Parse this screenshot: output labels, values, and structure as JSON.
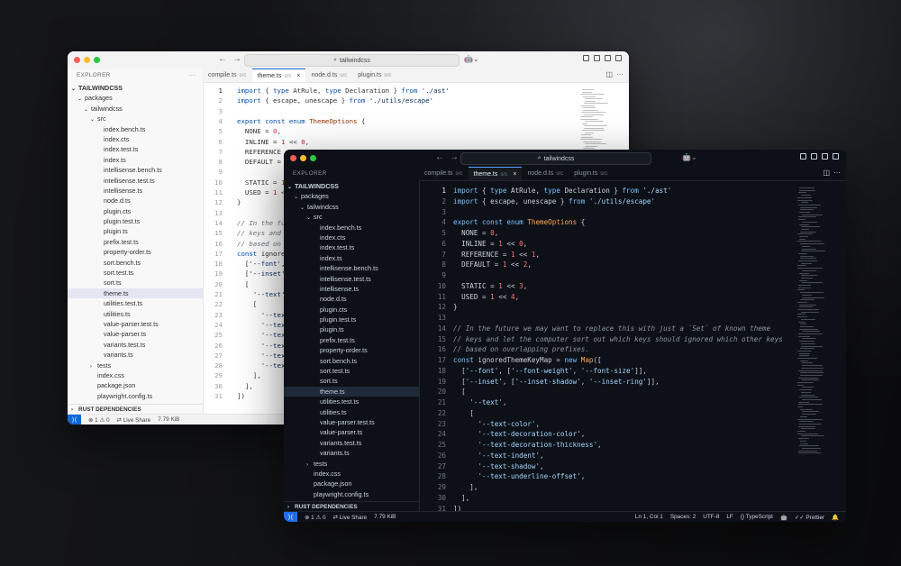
{
  "search_text": "tailwindcss",
  "tabs": [
    {
      "name": "compile.ts",
      "dir": "src",
      "active": false
    },
    {
      "name": "theme.ts",
      "dir": "src",
      "active": true
    },
    {
      "name": "node.d.ts",
      "dir": "src",
      "active": false
    },
    {
      "name": "plugin.ts",
      "dir": "src",
      "active": false
    }
  ],
  "explorer_label": "EXPLORER",
  "explorer_more": "···",
  "tree": [
    {
      "label": "TAILWINDCSS",
      "depth": 0,
      "twisty": "⌄",
      "bold": true
    },
    {
      "label": "packages",
      "depth": 1,
      "twisty": "⌄"
    },
    {
      "label": "tailwindcss",
      "depth": 2,
      "twisty": "⌄"
    },
    {
      "label": "src",
      "depth": 3,
      "twisty": "⌄"
    },
    {
      "label": "index.bench.ts",
      "depth": 4
    },
    {
      "label": "index.cts",
      "depth": 4
    },
    {
      "label": "index.test.ts",
      "depth": 4
    },
    {
      "label": "index.ts",
      "depth": 4
    },
    {
      "label": "intellisense.bench.ts",
      "depth": 4
    },
    {
      "label": "intellisense.test.ts",
      "depth": 4
    },
    {
      "label": "intellisense.ts",
      "depth": 4
    },
    {
      "label": "node.d.ts",
      "depth": 4
    },
    {
      "label": "plugin.cts",
      "depth": 4
    },
    {
      "label": "plugin.test.ts",
      "depth": 4
    },
    {
      "label": "plugin.ts",
      "depth": 4
    },
    {
      "label": "prefix.test.ts",
      "depth": 4
    },
    {
      "label": "property-order.ts",
      "depth": 4
    },
    {
      "label": "sort.bench.ts",
      "depth": 4
    },
    {
      "label": "sort.test.ts",
      "depth": 4
    },
    {
      "label": "sort.ts",
      "depth": 4
    },
    {
      "label": "theme.ts",
      "depth": 4,
      "selected": true
    },
    {
      "label": "utilities.test.ts",
      "depth": 4
    },
    {
      "label": "utilities.ts",
      "depth": 4
    },
    {
      "label": "value-parser.test.ts",
      "depth": 4
    },
    {
      "label": "value-parser.ts",
      "depth": 4
    },
    {
      "label": "variants.test.ts",
      "depth": 4
    },
    {
      "label": "variants.ts",
      "depth": 4
    },
    {
      "label": "tests",
      "depth": 3,
      "twisty": "›"
    },
    {
      "label": "index.css",
      "depth": 3
    },
    {
      "label": "package.json",
      "depth": 3
    },
    {
      "label": "playwright.config.ts",
      "depth": 3
    }
  ],
  "rust_label": "RUST DEPENDENCIES",
  "code": [
    [
      [
        "kw",
        "import"
      ],
      [
        "p",
        " { "
      ],
      [
        "kw",
        "type"
      ],
      [
        "p",
        " AtRule, "
      ],
      [
        "kw",
        "type"
      ],
      [
        "p",
        " Declaration } "
      ],
      [
        "kw",
        "from"
      ],
      [
        "p",
        " "
      ],
      [
        "str",
        "'./ast'"
      ]
    ],
    [
      [
        "kw",
        "import"
      ],
      [
        "p",
        " { escape, unescape } "
      ],
      [
        "kw",
        "from"
      ],
      [
        "p",
        " "
      ],
      [
        "str",
        "'./utils/escape'"
      ]
    ],
    [],
    [
      [
        "kw",
        "export const enum"
      ],
      [
        "p",
        " "
      ],
      [
        "ty",
        "ThemeOptions"
      ],
      [
        "p",
        " {"
      ]
    ],
    [
      [
        "p",
        "  NONE = "
      ],
      [
        "nm",
        "0"
      ],
      [
        "p",
        ","
      ]
    ],
    [
      [
        "p",
        "  INLINE = "
      ],
      [
        "nm",
        "1"
      ],
      [
        "p",
        " << "
      ],
      [
        "nm",
        "0"
      ],
      [
        "p",
        ","
      ]
    ],
    [
      [
        "p",
        "  REFERENCE = "
      ],
      [
        "nm",
        "1"
      ],
      [
        "p",
        " << "
      ],
      [
        "nm",
        "1"
      ],
      [
        "p",
        ","
      ]
    ],
    [
      [
        "p",
        "  DEFAULT = "
      ],
      [
        "nm",
        "1"
      ],
      [
        "p",
        " << "
      ],
      [
        "nm",
        "2"
      ],
      [
        "p",
        ","
      ]
    ],
    [],
    [
      [
        "p",
        "  STATIC = "
      ],
      [
        "nm",
        "1"
      ],
      [
        "p",
        " << "
      ],
      [
        "nm",
        "3"
      ],
      [
        "p",
        ","
      ]
    ],
    [
      [
        "p",
        "  USED = "
      ],
      [
        "nm",
        "1"
      ],
      [
        "p",
        " << "
      ],
      [
        "nm",
        "4"
      ],
      [
        "p",
        ","
      ]
    ],
    [
      [
        "p",
        "}"
      ]
    ],
    [],
    [
      [
        "cm",
        "// In the future we may want to replace this with just a `Set` of known theme"
      ]
    ],
    [
      [
        "cm",
        "// keys and let the computer sort out which keys should ignored which other keys"
      ]
    ],
    [
      [
        "cm",
        "// based on overlapping prefixes."
      ]
    ],
    [
      [
        "kw",
        "const"
      ],
      [
        "p",
        " ignoredThemeKeyMap = "
      ],
      [
        "kw",
        "new"
      ],
      [
        "p",
        " "
      ],
      [
        "ty",
        "Map"
      ],
      [
        "p",
        "(["
      ]
    ],
    [
      [
        "p",
        "  ["
      ],
      [
        "str",
        "'--font'"
      ],
      [
        "p",
        ", ["
      ],
      [
        "str",
        "'--font-weight'"
      ],
      [
        "p",
        ", "
      ],
      [
        "str",
        "'--font-size'"
      ],
      [
        "p",
        "]],"
      ]
    ],
    [
      [
        "p",
        "  ["
      ],
      [
        "str",
        "'--inset'"
      ],
      [
        "p",
        ", ["
      ],
      [
        "str",
        "'--inset-shadow'"
      ],
      [
        "p",
        ", "
      ],
      [
        "str",
        "'--inset-ring'"
      ],
      [
        "p",
        "]],"
      ]
    ],
    [
      [
        "p",
        "  ["
      ]
    ],
    [
      [
        "p",
        "    "
      ],
      [
        "str",
        "'--text'"
      ],
      [
        "p",
        ","
      ]
    ],
    [
      [
        "p",
        "    ["
      ]
    ],
    [
      [
        "p",
        "      "
      ],
      [
        "str",
        "'--text-color'"
      ],
      [
        "p",
        ","
      ]
    ],
    [
      [
        "p",
        "      "
      ],
      [
        "str",
        "'--text-decoration-color'"
      ],
      [
        "p",
        ","
      ]
    ],
    [
      [
        "p",
        "      "
      ],
      [
        "str",
        "'--text-decoration-thickness'"
      ],
      [
        "p",
        ","
      ]
    ],
    [
      [
        "p",
        "      "
      ],
      [
        "str",
        "'--text-indent'"
      ],
      [
        "p",
        ","
      ]
    ],
    [
      [
        "p",
        "      "
      ],
      [
        "str",
        "'--text-shadow'"
      ],
      [
        "p",
        ","
      ]
    ],
    [
      [
        "p",
        "      "
      ],
      [
        "str",
        "'--text-underline-offset'"
      ],
      [
        "p",
        ","
      ]
    ],
    [
      [
        "p",
        "    ],"
      ]
    ],
    [
      [
        "p",
        "  ],"
      ]
    ],
    [
      [
        "p",
        "])"
      ]
    ]
  ],
  "status": {
    "counts": "⊗ 1 ⚠ 0",
    "live_share": "Live Share",
    "size": "7.79 KiB",
    "position": "Ln 1, Col 1",
    "spaces": "Spaces: 2",
    "encoding": "UTF-8",
    "eol": "LF",
    "language": "{} TypeScript",
    "prettier": "Prettier"
  },
  "icons": {
    "remote": "remote-icon",
    "copilot": "copilot-icon",
    "bell": "bell-icon",
    "split": "split-editor-icon"
  },
  "colors": {
    "light_accent": "#0969da",
    "dark_accent": "#1f6feb",
    "dark_bg": "#0d1117"
  }
}
